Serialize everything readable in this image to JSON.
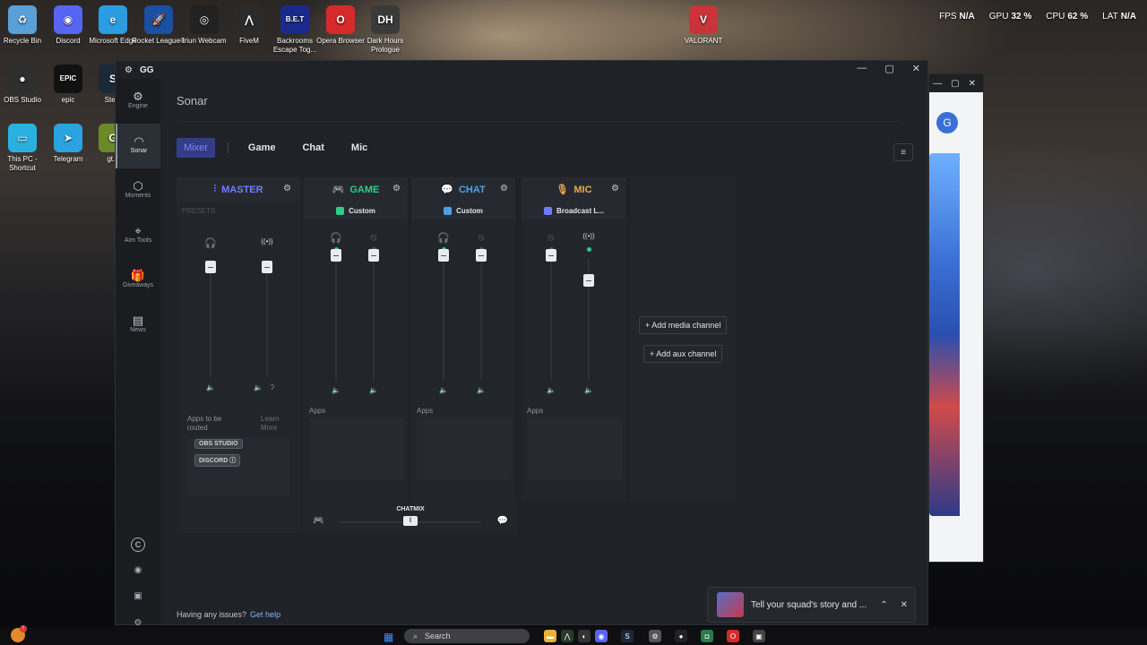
{
  "stats": {
    "fps_label": "FPS",
    "fps_value": "N/A",
    "gpu_label": "GPU",
    "gpu_value": "32 %",
    "cpu_label": "CPU",
    "cpu_value": "62 %",
    "lat_label": "LAT",
    "lat_value": "N/A"
  },
  "desktop_icons": [
    {
      "label": "Recycle Bin",
      "glyph": "♻",
      "color": "#5aa0d8"
    },
    {
      "label": "Discord",
      "glyph": "◉",
      "color": "#5865f2"
    },
    {
      "label": "Microsoft Edge",
      "glyph": "e",
      "color": "#2a9de0"
    },
    {
      "label": "Rocket League®",
      "glyph": "🚀",
      "color": "#1b4fa0"
    },
    {
      "label": "Iriun Webcam",
      "glyph": "◎",
      "color": "#222222"
    },
    {
      "label": "FiveM",
      "glyph": "⋀",
      "color": "#2a2a2a"
    },
    {
      "label": "Backrooms Escape Tog...",
      "glyph": "B.E.T",
      "color": "#1a2a8a"
    },
    {
      "label": "Opera Browser",
      "glyph": "O",
      "color": "#d62a2a"
    },
    {
      "label": "Dark Hours Prologue",
      "glyph": "DH",
      "color": "#3a3a3a"
    },
    {
      "label": "VALORANT",
      "glyph": "V",
      "color": "#c8343a"
    },
    {
      "label": "OBS Studio",
      "glyph": "●",
      "color": "#2e2e2e"
    },
    {
      "label": "epic",
      "glyph": "EPIC",
      "color": "#111111"
    },
    {
      "label": "Ste...",
      "glyph": "S",
      "color": "#1b2838"
    },
    {
      "label": "This PC - Shortcut",
      "glyph": "▭",
      "color": "#2ab0e0"
    },
    {
      "label": "Telegram",
      "glyph": "➤",
      "color": "#2aa3e0"
    },
    {
      "label": "gt...",
      "glyph": "G",
      "color": "#6a8a2a"
    }
  ],
  "bg_window": {
    "avatar_letter": "G",
    "badge": "1"
  },
  "gg": {
    "app_name": "GG",
    "window_controls": [
      "—",
      "▢",
      "✕"
    ],
    "sidebar": [
      {
        "label": "Engine",
        "icon": "⚙"
      },
      {
        "label": "Sonar",
        "icon": "◠"
      },
      {
        "label": "Moments",
        "icon": "⬡"
      },
      {
        "label": "Aim Tools",
        "icon": "⌖"
      },
      {
        "label": "Giveaways",
        "icon": "🎁"
      },
      {
        "label": "News",
        "icon": "▤"
      }
    ],
    "sidebar_bottom": [
      {
        "name": "profile-c-icon",
        "glyph": "C"
      },
      {
        "name": "discord-icon",
        "glyph": "◉"
      },
      {
        "name": "feedback-icon",
        "glyph": "▣"
      },
      {
        "name": "settings-icon",
        "glyph": "⚙"
      }
    ],
    "page_title": "Sonar",
    "tabs": [
      "Mixer",
      "Game",
      "Chat",
      "Mic"
    ],
    "menu_icon": "≡",
    "channels": {
      "master": {
        "title": "MASTER",
        "icon": "⫶",
        "color": "#6f7cff",
        "presets": "PRESETS"
      },
      "game": {
        "title": "GAME",
        "icon": "🎮",
        "color": "#2ccf86",
        "preset": "Custom"
      },
      "chat": {
        "title": "CHAT",
        "icon": "💬",
        "color": "#4aa3e8",
        "preset": "Custom"
      },
      "mic": {
        "title": "MIC",
        "icon": "🎙",
        "color": "#f0a64a",
        "preset": "Broadcast L..."
      }
    },
    "fader_glyphs": {
      "headphones": "🎧",
      "broadcast": "((•))",
      "broadcast_off": "⦸",
      "headphones_off": "⦸",
      "mute": "🔈",
      "mute_alt": "ʔ"
    },
    "apps_label": "Apps",
    "apps_to_be_routed": "Apps to be routed",
    "learn_more": "Learn More",
    "routed_chips": [
      "OBS STUDIO",
      "DISCORD ⓘ"
    ],
    "chatmix": {
      "label": "CHATMIX",
      "handle": "‖",
      "left_icon": "🎮",
      "right_icon": "💬"
    },
    "add_media_channel": "Add media channel",
    "add_aux_channel": "Add aux channel",
    "issues_text": "Having any issues?",
    "get_help": "Get help"
  },
  "toast": {
    "text": "Tell your squad's story and ...",
    "collapse": "⌃",
    "close": "✕"
  },
  "taskbar": {
    "search_placeholder": "Search"
  }
}
